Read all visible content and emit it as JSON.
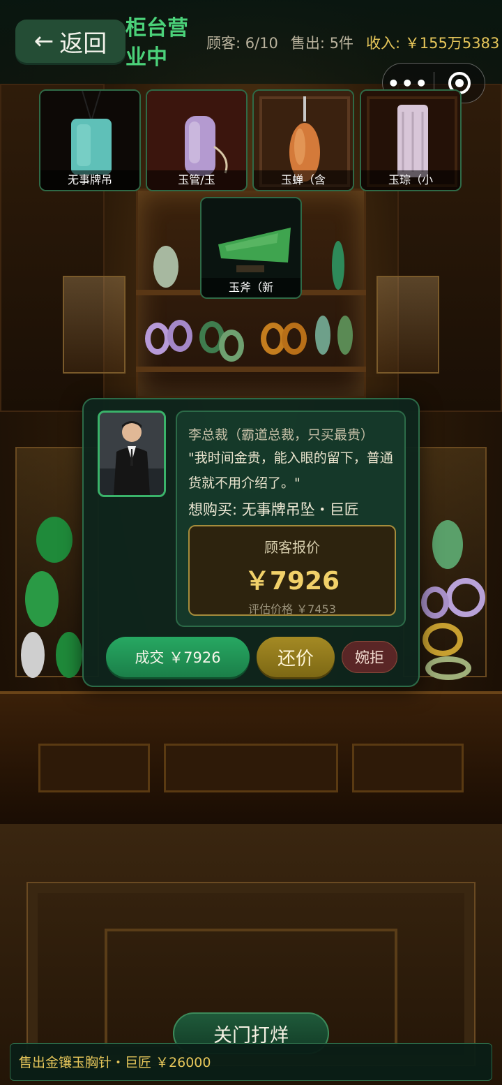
{
  "header": {
    "back_label": "返回",
    "shop_status": "柜台营业中",
    "customers": "顾客: 6/10",
    "sold": "售出: 5件",
    "income": "收入: ￥155万5383"
  },
  "items": [
    {
      "name": "无事牌吊",
      "color": "#5fc0b8"
    },
    {
      "name": "玉管/玉",
      "color": "#b49ad0"
    },
    {
      "name": "玉蝉（含",
      "color": "#d47a3a"
    },
    {
      "name": "玉琮（小",
      "color": "#d8c6d8"
    },
    {
      "name": "玉斧（新",
      "color": "#3fa44f"
    }
  ],
  "customer": {
    "name": "李总裁（霸道总裁，只买最贵）",
    "quote": "\"我时间金贵，能入眼的留下，普通货就不用介绍了。\"",
    "wants": "想购买: 无事牌吊坠・巨匠",
    "offer_title": "顾客报价",
    "offer_price": "￥7926",
    "eval_price": "评估价格 ￥7453"
  },
  "actions": {
    "deal_label": "成交 ￥7926",
    "counter_label": "还价",
    "reject_label": "婉拒"
  },
  "footer": {
    "close_shop_label": "关门打烊",
    "ticker": "售出金镶玉胸针・巨匠 ￥26000"
  },
  "colors": {
    "accent_green": "#4bd27a",
    "gold": "#e6c65a",
    "panel": "#0e241c"
  }
}
